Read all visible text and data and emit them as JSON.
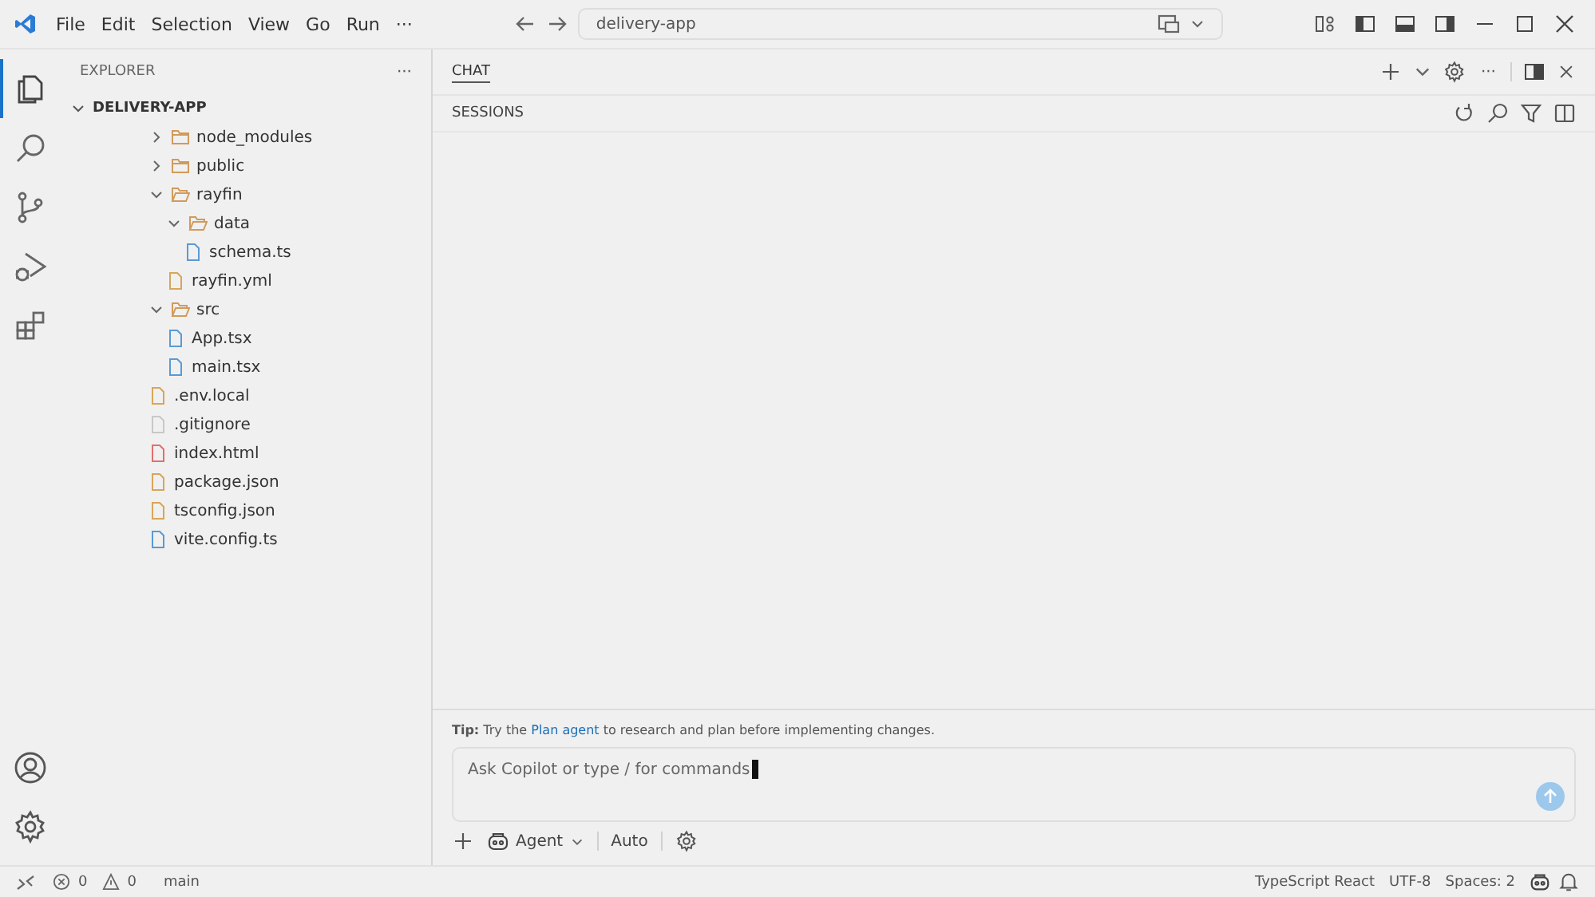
{
  "title_bar": {
    "menu": [
      "File",
      "Edit",
      "Selection",
      "View",
      "Go",
      "Run",
      "···"
    ],
    "search": {
      "value": "delivery-app"
    }
  },
  "activity_bar": {
    "top": [
      {
        "kind": "explorer",
        "selected": true
      },
      {
        "kind": "search",
        "selected": false
      },
      {
        "kind": "source-control",
        "selected": false
      },
      {
        "kind": "run",
        "selected": false
      },
      {
        "kind": "extensions",
        "selected": false
      }
    ],
    "bottom": [
      {
        "kind": "account"
      },
      {
        "kind": "settings"
      }
    ]
  },
  "explorer": {
    "title": "EXPLORER",
    "more": "···",
    "root": {
      "label": "DELIVERY-APP",
      "expanded": true
    },
    "tree": [
      {
        "kind": "folder",
        "label": "node_modules",
        "expanded": false
      },
      {
        "kind": "folder",
        "label": "public",
        "expanded": false
      },
      {
        "kind": "folder",
        "label": "rayfin",
        "expanded": true,
        "children": [
          {
            "kind": "folder",
            "label": "data",
            "expanded": true,
            "children": [
              {
                "kind": "file",
                "label": "schema.ts",
                "color": "#5a9ad6"
              }
            ]
          },
          {
            "kind": "file",
            "label": "rayfin.yml",
            "color": "#d7a65a"
          }
        ]
      },
      {
        "kind": "folder",
        "label": "src",
        "expanded": true,
        "children": [
          {
            "kind": "file",
            "label": "App.tsx",
            "color": "#5a9ad6"
          },
          {
            "kind": "file",
            "label": "main.tsx",
            "color": "#5a9ad6"
          }
        ]
      },
      {
        "kind": "file",
        "label": ".env.local",
        "color": "#d7a65a"
      },
      {
        "kind": "file",
        "label": ".gitignore",
        "color": "#c8c8c8"
      },
      {
        "kind": "file",
        "label": "index.html",
        "color": "#e0706a"
      },
      {
        "kind": "file",
        "label": "package.json",
        "color": "#d7a65a"
      },
      {
        "kind": "file",
        "label": "tsconfig.json",
        "color": "#d7a65a"
      },
      {
        "kind": "file",
        "label": "vite.config.ts",
        "color": "#5a9ad6"
      }
    ]
  },
  "chat": {
    "tab": "CHAT",
    "more": "···",
    "section": "SESSIONS",
    "tip": {
      "label": "Tip:",
      "before": "Try the",
      "link": "Plan agent",
      "after": "to research and plan before implementing changes."
    },
    "input": {
      "placeholder": "Ask Copilot or type / for commands"
    },
    "mode": "Agent",
    "model": "Auto"
  },
  "status_bar": {
    "errors": "0",
    "warnings": "0",
    "branch": "main",
    "language": "TypeScript React",
    "encoding": "UTF-8",
    "indent": "Spaces: 2"
  }
}
